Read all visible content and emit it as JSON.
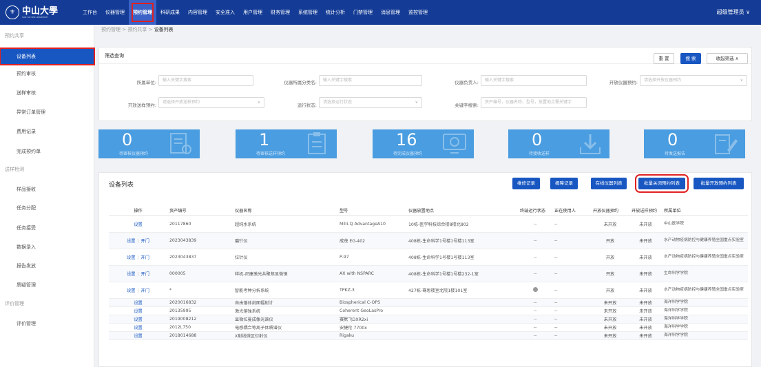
{
  "brand": {
    "name": "中山大學",
    "subtitle": "SUN YAT-SEN UNIVERSITY"
  },
  "nav": [
    "工作台",
    "仪器管理",
    "预约管理",
    "科研成果",
    "内容管理",
    "安全准入",
    "用户管理",
    "财务管理",
    "系统管理",
    "统计分析",
    "门禁管理",
    "消息管理",
    "监控管理"
  ],
  "nav_active": "预约管理",
  "user": "超级管理员 ∨",
  "sidebar": {
    "group1": "预约共享",
    "items1": [
      "设备列表",
      "预约审核",
      "送样审核",
      "异常订单管理",
      "费用记录",
      "完成预约单"
    ],
    "group2": "送样检测",
    "items2": [
      "样品接收",
      "任务分配",
      "任务接受",
      "数据录入",
      "报告发放",
      "质疑管理"
    ],
    "group3": "评价管理",
    "items3": [
      "评价管理"
    ]
  },
  "breadcrumb": {
    "a": "预约管理",
    "sep1": ">",
    "b": "预约共享",
    "sep2": ">",
    "c": "设备列表"
  },
  "filter": {
    "title": "筛选查询",
    "reset": "重 置",
    "search": "搜 索",
    "collapse": "收起筛选 ∧",
    "fields": [
      {
        "label": "所属单位:",
        "placeholder": "输入关键字搜索"
      },
      {
        "label": "仪器所属分类名:",
        "placeholder": "输入关键字搜索"
      },
      {
        "label": "仪器负责人:",
        "placeholder": "输入关键字搜索"
      },
      {
        "label": "开放仪器预约:",
        "placeholder": "请选择开放仪器预约"
      },
      {
        "label": "开放送样预约:",
        "placeholder": "请选择开放送样预约"
      },
      {
        "label": "运行状态:",
        "placeholder": "请选择运行状态"
      },
      {
        "label": "关键字搜索:",
        "placeholder": "资产编号，仪器名称，型号，放置地点需关键字"
      }
    ]
  },
  "stats": [
    {
      "num": "0",
      "label": "待审核仪器预约"
    },
    {
      "num": "1",
      "label": "待审核送样预约"
    },
    {
      "num": "16",
      "label": "待完成仪器预约"
    },
    {
      "num": "0",
      "label": "待接收送样"
    },
    {
      "num": "0",
      "label": "待发送报告"
    }
  ],
  "list": {
    "title": "设备列表",
    "buttons": [
      "维修记录",
      "报障记录",
      "在线仪器列表",
      "批量关闭预约列表",
      "批量开放预约列表"
    ],
    "headers": [
      "操作",
      "资产编号",
      "仪器名称",
      "型号",
      "仪器放置地点",
      "终端运行状态",
      "正在使用人",
      "开放仪器预约",
      "开放送样预约",
      "所属单位"
    ],
    "rows": [
      {
        "op1": "设置",
        "op2": "",
        "asset": "20117860",
        "name": "超纯水系统",
        "model": "Milli-Q AdvantageA10",
        "loc": "10栋-医学科技综合楼8楼北802",
        "term": "--",
        "user": "--",
        "inst": "未开放",
        "sample": "未开放",
        "unit": "中山医学院"
      },
      {
        "op1": "设置",
        "op2": "开门",
        "asset": "2023043839",
        "name": "磨针仪",
        "model": "成茂 EG-402",
        "loc": "408栋-生命科学1号楼1号楼113室",
        "term": "--",
        "user": "--",
        "inst": "开放",
        "sample": "未开放",
        "unit": "水产动物疫病防控与健康养殖全国重点实验室"
      },
      {
        "op1": "设置",
        "op2": "开门",
        "asset": "2023043837",
        "name": "拉针仪",
        "model": "P-97",
        "loc": "408栋-生命科学1号楼1号楼113室",
        "term": "--",
        "user": "--",
        "inst": "开放",
        "sample": "未开放",
        "unit": "水产动物疫病防控与健康养殖全国重点实验室"
      },
      {
        "op1": "设置",
        "op2": "开门",
        "asset": "000005",
        "name": "样机-尼康激光共聚焦显微镜",
        "model": "AX with NSPARC",
        "loc": "408栋-生命科学1号楼1号楼232-1室",
        "term": "--",
        "user": "--",
        "inst": "开放",
        "sample": "未开放",
        "unit": "生命科学学院"
      },
      {
        "op1": "设置",
        "op2": "开门",
        "asset": "*",
        "name": "智能考种分析系统",
        "model": "TPKZ-3",
        "loc": "427栋-骞思楼室北院1楼101室",
        "term": "dot",
        "user": "--",
        "inst": "开放",
        "sample": "未开放",
        "unit": "水产动物疫病防控与健康养殖全国重点实验室"
      },
      {
        "op1": "设置",
        "op2": "",
        "asset": "2020016832",
        "name": "自由落体剖面辐射计",
        "model": "Biospherical C-OPS",
        "loc": "",
        "term": "--",
        "user": "--",
        "inst": "未开放",
        "sample": "未开放",
        "unit": "海洋科学学院"
      },
      {
        "op1": "设置",
        "op2": "",
        "asset": "20135995",
        "name": "激光熔蚀系统",
        "model": "Coherent GeoLasPro",
        "loc": "",
        "term": "--",
        "user": "--",
        "inst": "未开放",
        "sample": "未开放",
        "unit": "海洋科学学院"
      },
      {
        "op1": "设置",
        "op2": "",
        "asset": "2019008212",
        "name": "显微拉曼成像光谱仪",
        "model": "赛默飞DXR2xi",
        "loc": "",
        "term": "--",
        "user": "--",
        "inst": "未开放",
        "sample": "未开放",
        "unit": "海洋科学学院"
      },
      {
        "op1": "设置",
        "op2": "",
        "asset": "2012L750",
        "name": "电感耦合等离子体质谱仪",
        "model": "安捷伦 7700x",
        "loc": "",
        "term": "--",
        "user": "--",
        "inst": "未开放",
        "sample": "未开放",
        "unit": "海洋科学学院"
      },
      {
        "op1": "设置",
        "op2": "",
        "asset": "2018014688",
        "name": "X射线微区衍射仪",
        "model": "Rigaku",
        "loc": "",
        "term": "--",
        "user": "--",
        "inst": "未开放",
        "sample": "未开放",
        "unit": "海洋科学学院"
      }
    ]
  }
}
